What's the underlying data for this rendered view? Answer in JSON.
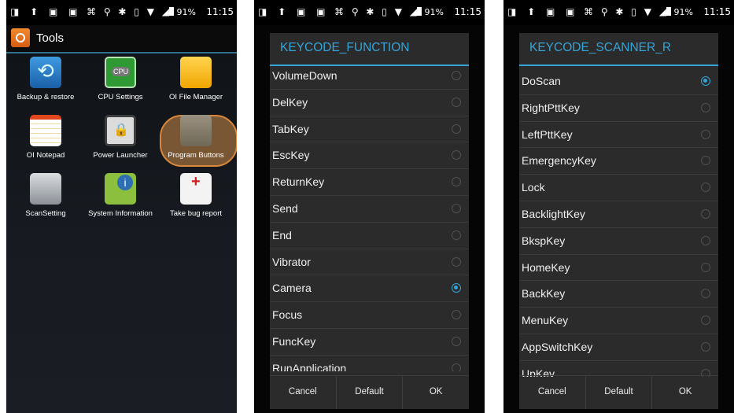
{
  "status": {
    "left_icons": "◨ ⬆ ▣ ▣",
    "mid_icons": "⌘ ⚲ ✱ ▯ ▼ ◢",
    "battery": "91%",
    "time": "11:15"
  },
  "launcher": {
    "title": "Tools",
    "apps": [
      {
        "label": "Backup & restore",
        "icon": "backup-icon"
      },
      {
        "label": "CPU Settings",
        "icon": "cpu-icon"
      },
      {
        "label": "OI File Manager",
        "icon": "folder-icon"
      },
      {
        "label": "OI Notepad",
        "icon": "notepad-icon"
      },
      {
        "label": "Power Launcher",
        "icon": "power-launcher-icon"
      },
      {
        "label": "Program Buttons",
        "icon": "program-buttons-icon"
      },
      {
        "label": "ScanSetting",
        "icon": "scan-icon"
      },
      {
        "label": "System Information",
        "icon": "info-icon"
      },
      {
        "label": "Take bug report",
        "icon": "bug-report-icon"
      }
    ]
  },
  "dialog1": {
    "title": "KEYCODE_FUNCTION",
    "items": [
      {
        "label": "VolumeDown",
        "selected": false
      },
      {
        "label": "DelKey",
        "selected": false
      },
      {
        "label": "TabKey",
        "selected": false
      },
      {
        "label": "EscKey",
        "selected": false
      },
      {
        "label": "ReturnKey",
        "selected": false
      },
      {
        "label": "Send",
        "selected": false
      },
      {
        "label": "End",
        "selected": false
      },
      {
        "label": "Vibrator",
        "selected": false
      },
      {
        "label": "Camera",
        "selected": true
      },
      {
        "label": "Focus",
        "selected": false
      },
      {
        "label": "FuncKey",
        "selected": false
      },
      {
        "label": "RunApplication",
        "selected": false
      }
    ],
    "buttons": {
      "cancel": "Cancel",
      "default": "Default",
      "ok": "OK"
    }
  },
  "dialog2": {
    "title": "KEYCODE_SCANNER_R",
    "items": [
      {
        "label": "DoScan",
        "selected": true
      },
      {
        "label": "RightPttKey",
        "selected": false
      },
      {
        "label": "LeftPttKey",
        "selected": false
      },
      {
        "label": "EmergencyKey",
        "selected": false
      },
      {
        "label": "Lock",
        "selected": false
      },
      {
        "label": "BacklightKey",
        "selected": false
      },
      {
        "label": "BkspKey",
        "selected": false
      },
      {
        "label": "HomeKey",
        "selected": false
      },
      {
        "label": "BackKey",
        "selected": false
      },
      {
        "label": "MenuKey",
        "selected": false
      },
      {
        "label": "AppSwitchKey",
        "selected": false
      },
      {
        "label": "UpKey",
        "selected": false
      }
    ],
    "buttons": {
      "cancel": "Cancel",
      "default": "Default",
      "ok": "OK"
    }
  },
  "colors": {
    "accent": "#35a4d8",
    "highlight": "#7a5734"
  }
}
